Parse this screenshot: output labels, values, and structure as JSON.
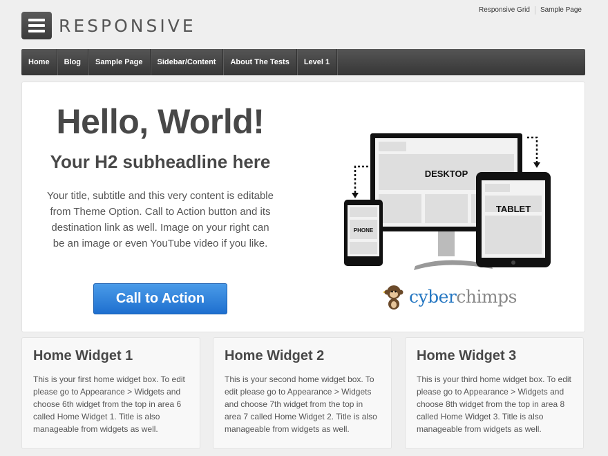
{
  "top_links": [
    "Responsive Grid",
    "Sample Page"
  ],
  "logo": {
    "text": "RESPONSIVE",
    "icon": "menu-icon"
  },
  "nav": [
    "Home",
    "Blog",
    "Sample Page",
    "Sidebar/Content",
    "About The Tests",
    "Level 1"
  ],
  "hero": {
    "title": "Hello, World!",
    "subtitle": "Your H2 subheadline here",
    "body": "Your title, subtitle and this very content is editable from Theme Option. Call to Action button and its destination link as well. Image on your right can be an image or even YouTube video if you like.",
    "cta": "Call to Action",
    "devices": {
      "desktop": "DESKTOP",
      "tablet": "TABLET",
      "phone": "PHONE"
    },
    "brand": {
      "part1": "cyber",
      "part2": "chimps"
    }
  },
  "widgets": [
    {
      "title": "Home Widget 1",
      "text": "This is your first home widget box. To edit please go to Appearance > Widgets and choose 6th widget from the top in area 6 called Home Widget 1. Title is also manageable from widgets as well."
    },
    {
      "title": "Home Widget 2",
      "text": "This is your second home widget box. To edit please go to Appearance > Widgets and choose 7th widget from the top in area 7 called Home Widget 2. Title is also manageable from widgets as well."
    },
    {
      "title": "Home Widget 3",
      "text": "This is your third home widget box. To edit please go to Appearance > Widgets and choose 8th widget from the top in area 8 called Home Widget 3. Title is also manageable from widgets as well."
    }
  ],
  "colors": {
    "accent": "#2577c2",
    "nav_bg": "#444444",
    "page_bg": "#efefef"
  }
}
